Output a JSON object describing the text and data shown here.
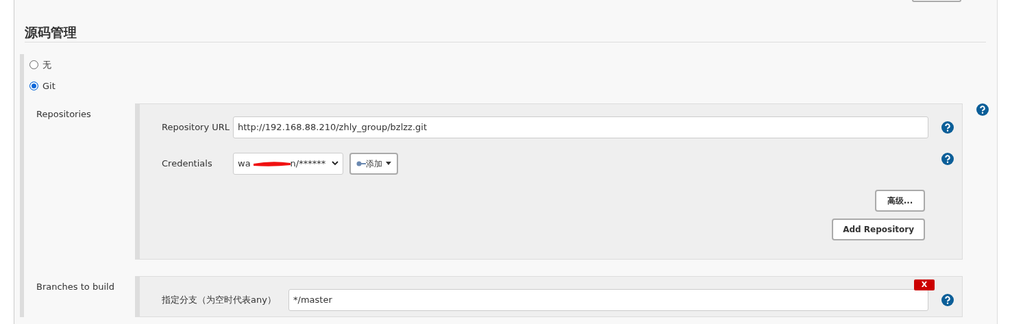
{
  "section_title": "源码管理",
  "scm_options": [
    {
      "label": "无",
      "selected": false
    },
    {
      "label": "Git",
      "selected": true
    }
  ],
  "repositories": {
    "label": "Repositories",
    "url": {
      "label": "Repository URL",
      "value": "http://192.168.88.210/zhly_group/bzlzz.git"
    },
    "credentials": {
      "label": "Credentials",
      "value_start": "wa",
      "value_end": "n/******",
      "add_button": "添加"
    },
    "advanced_button": "高级...",
    "add_repository_button": "Add Repository"
  },
  "branches": {
    "label": "Branches to build",
    "delete_button": "X",
    "branch_specifier": {
      "label": "指定分支（为空时代表any）",
      "value": "*/master"
    }
  }
}
